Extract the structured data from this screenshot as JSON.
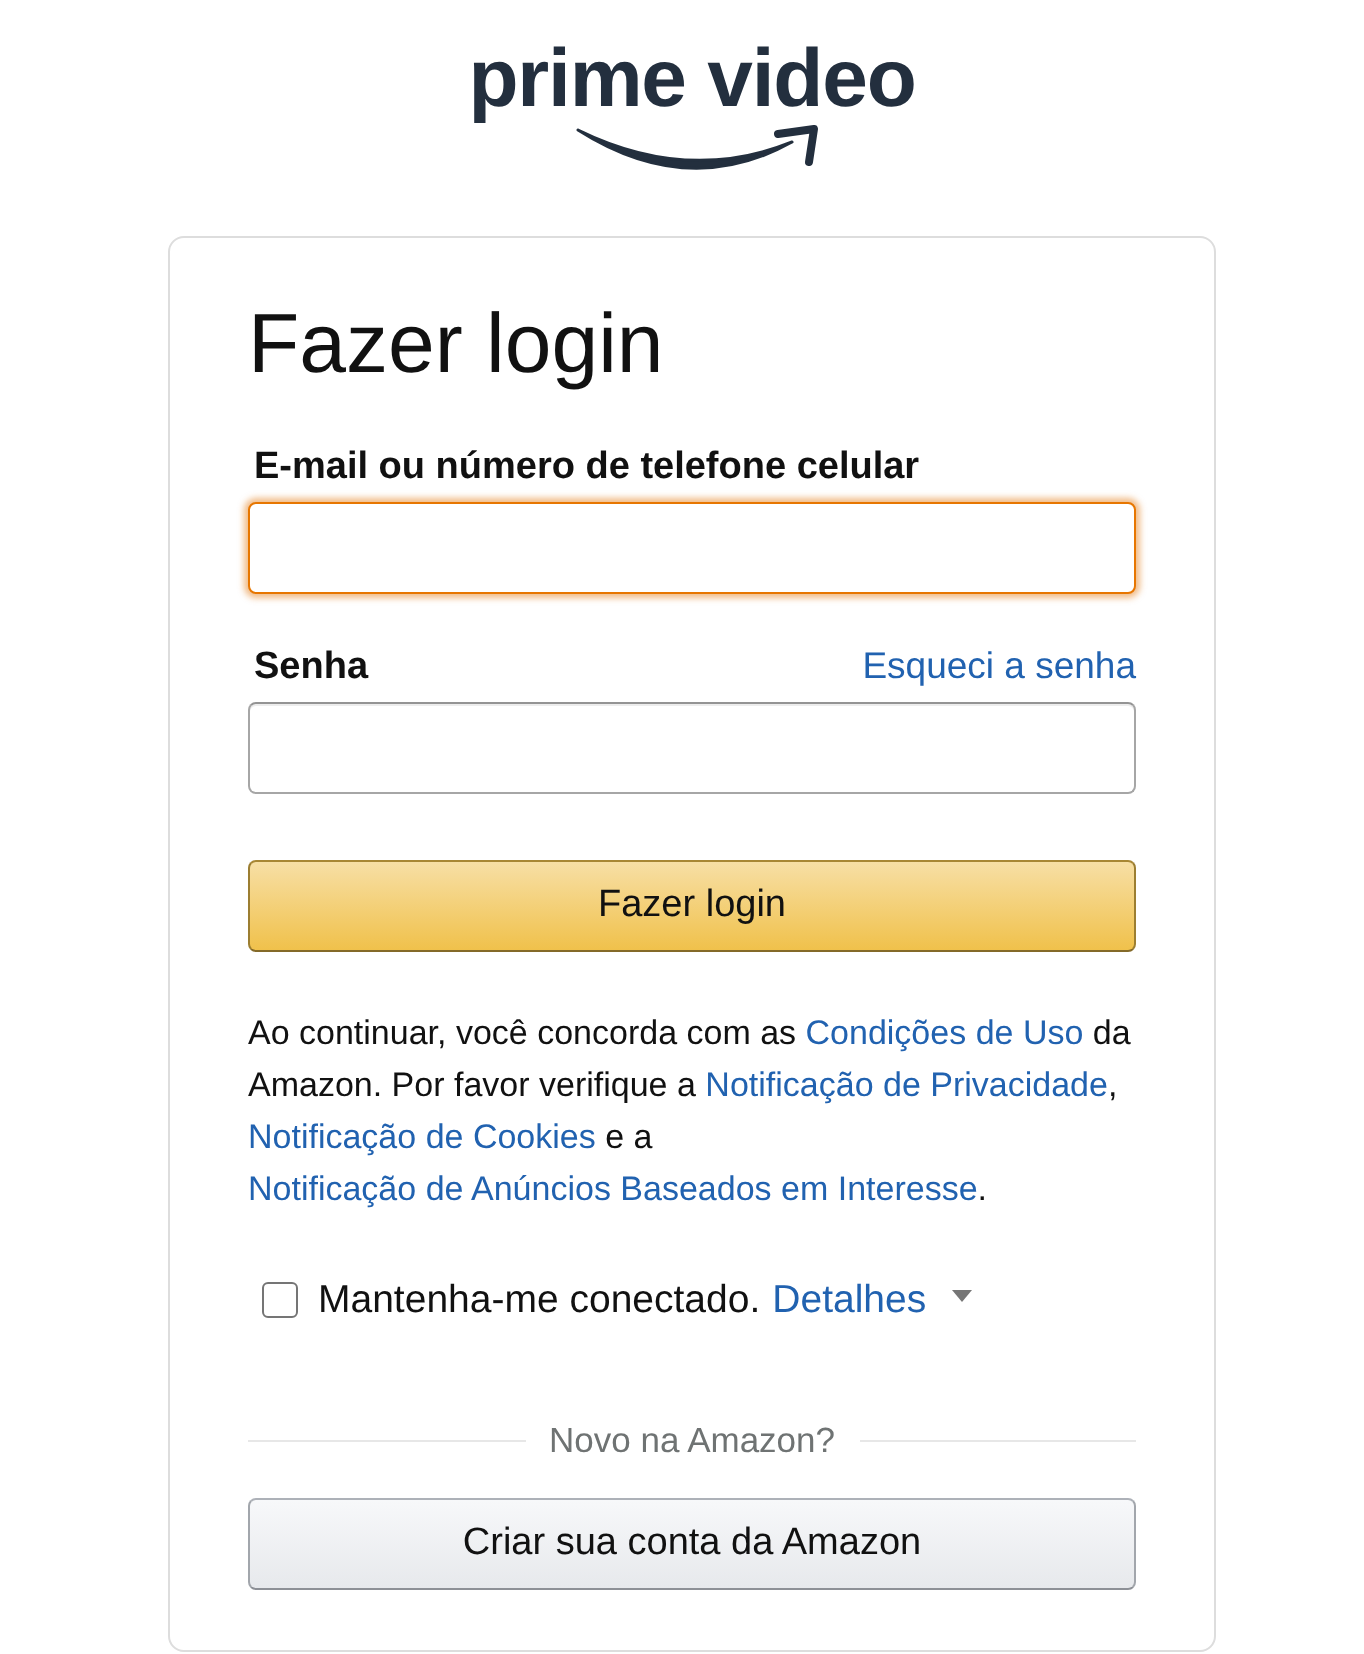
{
  "logo": {
    "text": "prime video"
  },
  "title": "Fazer login",
  "fields": [
    {
      "label": "E-mail ou número de telefone celular",
      "focused": true
    },
    {
      "label": "Senha",
      "link": "Esqueci a senha",
      "focused": false
    }
  ],
  "submit_button": "Fazer login",
  "legal_notice": [
    {
      "kind": "text",
      "text": "Ao continuar, você concorda com as "
    },
    {
      "kind": "link",
      "text": "Condições de Uso"
    },
    {
      "kind": "text",
      "text": " da Amazon. Por favor verifique a "
    },
    {
      "kind": "link",
      "text": "Notificação de Privacidade"
    },
    {
      "kind": "text",
      "text": ", "
    },
    {
      "kind": "link",
      "text": "Notificação de Cookies"
    },
    {
      "kind": "text",
      "text": " e a "
    },
    {
      "kind": "link",
      "text": "Notificação de Anúncios Baseados em Interesse"
    },
    {
      "kind": "text",
      "text": "."
    }
  ],
  "remember_me": {
    "label": "Mantenha-me conectado.",
    "checked": false,
    "details_link": "Detalhes"
  },
  "divider": "Novo na Amazon?",
  "create_account_button": "Criar sua conta da Amazon"
}
